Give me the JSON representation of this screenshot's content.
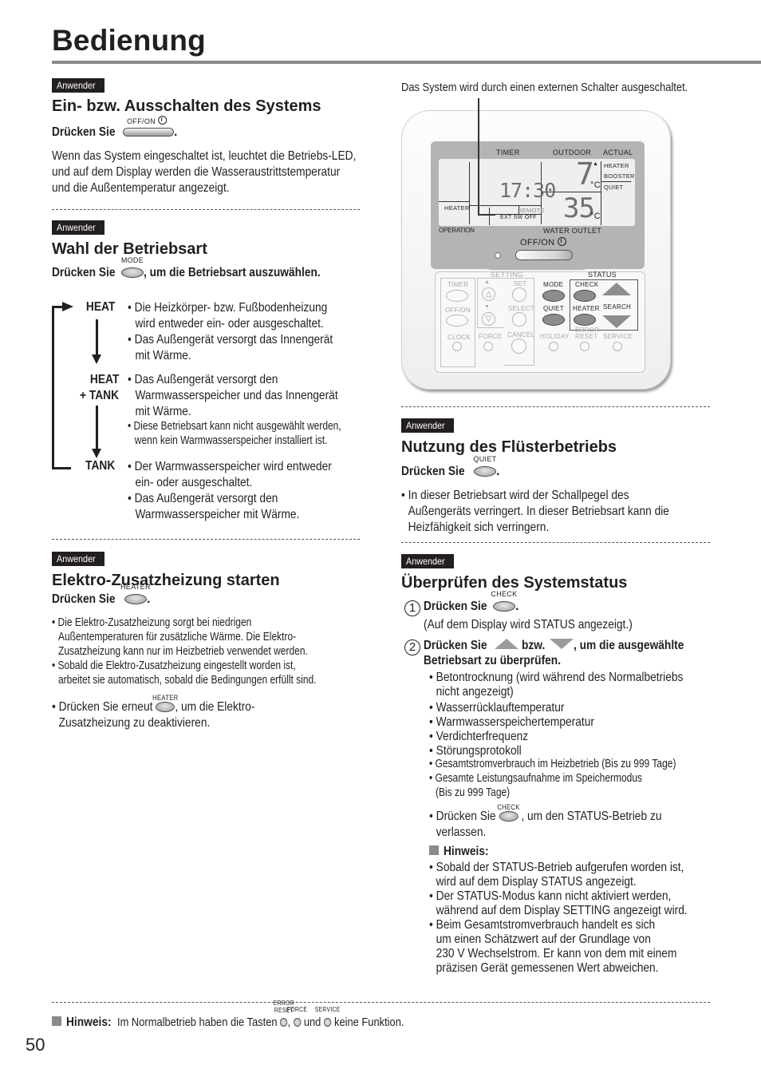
{
  "page": {
    "title": "Bedienung",
    "number": "50",
    "accent_rule_color": "#8a8a8a"
  },
  "sections": {
    "onoff": {
      "badge": "Anwender",
      "heading": "Ein- bzw. Ausschalten des Systems",
      "press_prefix": "Drücken Sie",
      "press_key": "OFF/ON",
      "press_suffix": ".",
      "body": [
        "Wenn das System eingeschaltet ist, leuchtet die Betriebs-LED,",
        "und auf dem Display werden die Wasseraustrittstemperatur",
        "und die Außentemperatur angezeigt."
      ]
    },
    "mode": {
      "badge": "Anwender",
      "heading": "Wahl der Betriebsart",
      "press_prefix": "Drücken Sie",
      "press_key": "MODE",
      "press_suffix": ", um die Betriebsart auszuwählen.",
      "modes": [
        {
          "label_lines": [
            "HEAT"
          ],
          "bullets": [
            [
              "Die Heizkörper- bzw. Fußbodenheizung",
              "wird entweder ein- oder ausgeschaltet."
            ],
            [
              "Das Außengerät versorgt das Innengerät",
              "mit Wärme."
            ]
          ]
        },
        {
          "label_lines": [
            "HEAT",
            "+ TANK"
          ],
          "bullets": [
            [
              "Das Außengerät versorgt den",
              "Warmwasserspeicher und das Innengerät",
              "mit Wärme."
            ],
            [
              "Diese Betriebsart kann nicht ausgewählt werden,",
              "wenn kein Warmwasserspeicher installiert ist."
            ]
          ]
        },
        {
          "label_lines": [
            "TANK"
          ],
          "bullets": [
            [
              "Der Warmwasserspeicher wird entweder",
              "ein- oder ausgeschaltet."
            ],
            [
              "Das Außengerät versorgt den",
              "Warmwasserspeicher mit Wärme."
            ]
          ]
        }
      ]
    },
    "heater": {
      "badge": "Anwender",
      "heading": "Elektro-Zusatzheizung starten",
      "press_prefix": "Drücken Sie",
      "press_key": "HEATER",
      "press_suffix": ".",
      "bullets": [
        [
          "Die Elektro-Zusatzheizung sorgt bei niedrigen",
          "Außentemperaturen für zusätzliche Wärme. Die Elektro-",
          "Zusatzheizung kann nur im Heizbetrieb verwendet werden."
        ],
        [
          "Sobald die Elektro-Zusatzheizung eingestellt worden ist,",
          "arbeitet sie automatisch, sobald die Bedingungen erfüllt sind."
        ]
      ],
      "deactivate_prefix": "Drücken Sie erneut",
      "deactivate_key": "HEATER",
      "deactivate_suffix": ", um die Elektro-",
      "deactivate_line2": "Zusatzheizung zu deaktivieren."
    },
    "remote_figure": {
      "callout": "Das System wird durch einen externen Schalter ausgeschaltet.",
      "lcd": {
        "timer_label": "TIMER",
        "outdoor_label": "OUTDOOR",
        "actual_label": "ACTUAL",
        "time": "17:30",
        "outdoor_temp": "7",
        "water_temp": "35",
        "unit": "°C",
        "right_labels": [
          "HEATER",
          "BOOSTER",
          "QUIET"
        ],
        "heater_label": "HEATER",
        "remote_label": "REMOTE",
        "ext_sw_label": "EXT SW OFF",
        "operation_label": "OPERATION",
        "water_outlet_label": "WATER OUTLET",
        "offon_label": "OFF/ON"
      },
      "buttons": {
        "setting_label": "SETTING",
        "status_label": "STATUS",
        "timer": "TIMER",
        "offon": "OFF/ON",
        "clock": "CLOCK",
        "set": "SET",
        "select": "SELECT",
        "force": "FORCE",
        "cancel": "CANCEL",
        "mode": "MODE",
        "check": "CHECK",
        "quiet": "QUIET",
        "heater": "HEATER",
        "search": "SEARCH",
        "holiday": "HOLIDAY",
        "error": "ERROR",
        "reset": "RESET",
        "service": "SERVICE"
      }
    },
    "quiet": {
      "badge": "Anwender",
      "heading": "Nutzung des Flüsterbetriebs",
      "press_prefix": "Drücken Sie",
      "press_key": "QUIET",
      "press_suffix": ".",
      "bullet": [
        "In dieser Betriebsart wird der Schallpegel des",
        "Außengeräts verringert. In dieser Betriebsart kann die",
        "Heizfähigkeit sich verringern."
      ]
    },
    "status": {
      "badge": "Anwender",
      "heading": "Überprüfen des Systemstatus",
      "step1_num": "1",
      "step1_prefix": "Drücken Sie",
      "step1_key": "CHECK",
      "step1_suffix": ".",
      "step1_note": "(Auf dem Display wird STATUS angezeigt.)",
      "step2_num": "2",
      "step2_prefix": "Drücken Sie",
      "step2_mid": "bzw.",
      "step2_suffix": ", um die ausgewählte",
      "step2_line2": "Betriebsart zu überprüfen.",
      "items": [
        [
          "Betontrocknung (wird während des Normalbetriebs",
          "nicht angezeigt)"
        ],
        [
          "Wasserrücklauftemperatur"
        ],
        [
          "Warmwasserspeichertemperatur"
        ],
        [
          "Verdichterfrequenz"
        ],
        [
          "Störungsprotokoll"
        ],
        [
          "Gesamtstromverbrauch im Heizbetrieb (Bis zu 999 Tage)"
        ],
        [
          "Gesamte Leistungsaufnahme im Speichermodus",
          "(Bis zu 999 Tage)"
        ]
      ],
      "exit_prefix": "Drücken Sie",
      "exit_key": "CHECK",
      "exit_suffix": ", um den STATUS-Betrieb zu",
      "exit_line2": "verlassen.",
      "note_title": "Hinweis:",
      "notes": [
        [
          "Sobald der STATUS-Betrieb aufgerufen worden ist,",
          "wird auf dem Display STATUS angezeigt."
        ],
        [
          "Der STATUS-Modus kann nicht aktiviert werden,",
          "während auf dem Display SETTING angezeigt wird."
        ],
        [
          "Beim Gesamtstromverbrauch handelt es sich",
          "um einen Schätzwert auf der Grundlage von",
          "230 V Wechselstrom. Er kann von dem mit einem",
          "präzisen Gerät gemessenen Wert abweichen."
        ]
      ]
    },
    "footer_note": {
      "title": "Hinweis:",
      "prefix": "Im Normalbetrieb haben die Tasten",
      "key1_top": "ERROR",
      "key1_bottom": "RESET",
      "sep1": ",",
      "key2": "FORCE",
      "sep2": "und",
      "key3": "SERVICE",
      "suffix": "keine Funktion."
    }
  }
}
